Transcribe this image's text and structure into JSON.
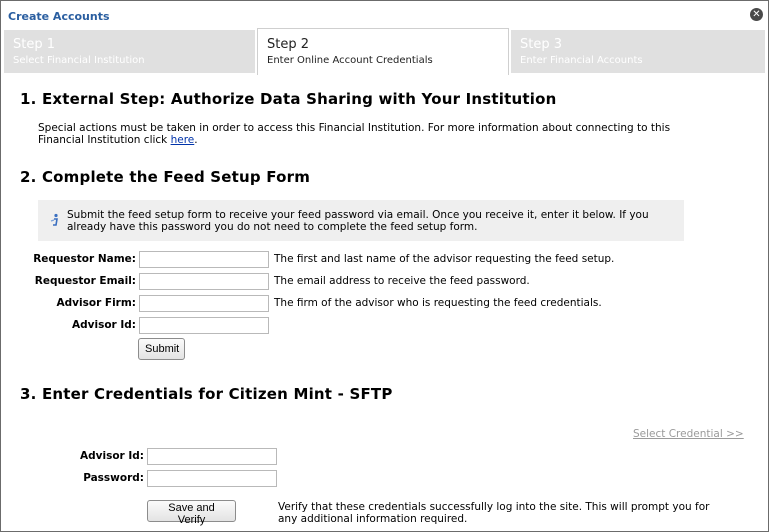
{
  "dialog": {
    "title": "Create Accounts"
  },
  "tabs": [
    {
      "title": "Step 1",
      "subtitle": "Select Financial Institution"
    },
    {
      "title": "Step 2",
      "subtitle": "Enter Online Account Credentials"
    },
    {
      "title": "Step 3",
      "subtitle": "Enter Financial Accounts"
    }
  ],
  "section1": {
    "heading": "1. External Step: Authorize Data Sharing with Your Institution",
    "text": "Special actions must be taken in order to access this Financial Institution. For more information about connecting to this Financial Institution click ",
    "link": "here",
    "text_end": "."
  },
  "section2": {
    "heading": "2. Complete the Feed Setup Form",
    "info": "Submit the feed setup form to receive your feed password via email. Once you receive it, enter it below. If you already have this password you do not need to complete the feed setup form.",
    "fields": [
      {
        "label": "Requestor Name:",
        "value": "",
        "desc": "The first and last name of the advisor requesting the feed setup."
      },
      {
        "label": "Requestor Email:",
        "value": "",
        "desc": "The email address to receive the feed password."
      },
      {
        "label": "Advisor Firm:",
        "value": "",
        "desc": "The firm of the advisor who is requesting the feed credentials."
      },
      {
        "label": "Advisor Id:",
        "value": "",
        "desc": ""
      }
    ],
    "submit": "Submit"
  },
  "section3": {
    "heading": "3. Enter Credentials for Citizen Mint - SFTP",
    "select_credential": "Select Credential >>",
    "fields": [
      {
        "label": "Advisor Id:",
        "value": ""
      },
      {
        "label": "Password:",
        "value": ""
      }
    ],
    "save_button": "Save and Verify",
    "verify_text": "Verify that these credentials successfully log into the site. This will prompt you for any additional information required."
  }
}
